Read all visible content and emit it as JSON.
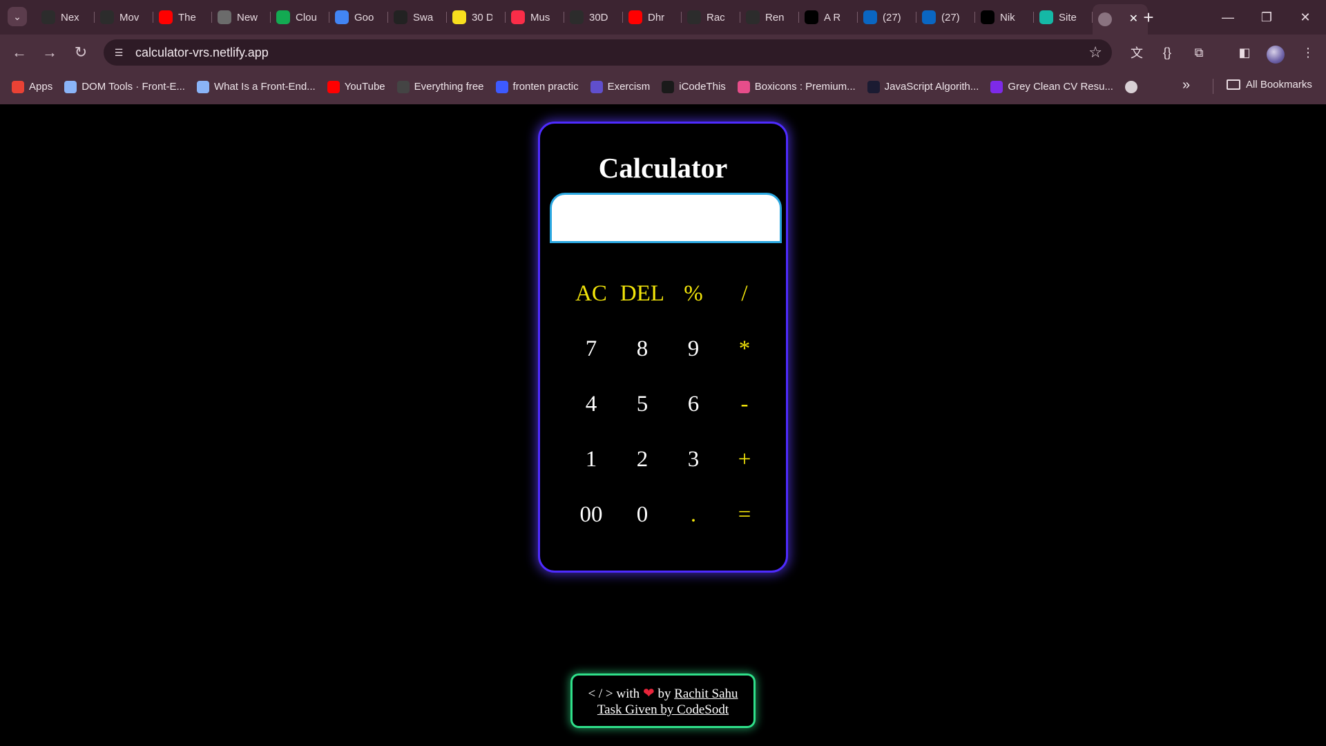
{
  "browser": {
    "tabs": [
      {
        "title": "Nex",
        "favicon": "openai-icon",
        "color": "#2c2c2c"
      },
      {
        "title": "Mov",
        "favicon": "m-icon",
        "color": "#2c2c2c"
      },
      {
        "title": "The",
        "favicon": "youtube-icon",
        "color": "#ff0000"
      },
      {
        "title": "New",
        "favicon": "chrome-icon",
        "color": "#6b6b6b"
      },
      {
        "title": "Clou",
        "favicon": "mongodb-leaf-icon",
        "color": "#13aa52"
      },
      {
        "title": "Goo",
        "favicon": "google-translate-icon",
        "color": "#4285f4"
      },
      {
        "title": "Swa",
        "favicon": "ss-icon",
        "color": "#222222"
      },
      {
        "title": "30 D",
        "favicon": "js-icon",
        "color": "#f7df1e"
      },
      {
        "title": "Mus",
        "favicon": "music-icon",
        "color": "#fa2d48"
      },
      {
        "title": "30D",
        "favicon": "github-icon",
        "color": "#2c2c2c"
      },
      {
        "title": "Dhr",
        "favicon": "youtube-icon",
        "color": "#ff0000"
      },
      {
        "title": "Rac",
        "favicon": "github-icon",
        "color": "#2c2c2c"
      },
      {
        "title": "Ren",
        "favicon": "render-icon",
        "color": "#2c2c2c"
      },
      {
        "title": "A R",
        "favicon": "triangle-icon",
        "color": "#000000"
      },
      {
        "title": "(27)",
        "favicon": "linkedin-icon",
        "color": "#0a66c2"
      },
      {
        "title": "(27)",
        "favicon": "linkedin-icon",
        "color": "#0a66c2"
      },
      {
        "title": "Nik",
        "favicon": "triangle-icon",
        "color": "#000000"
      },
      {
        "title": "Site",
        "favicon": "netlify-icon",
        "color": "#15b8a6"
      }
    ],
    "active_tab_close": "✕",
    "url": "calculator-vrs.netlify.app",
    "bookmarks": [
      {
        "label": "Apps",
        "icon": "apps-grid-icon",
        "color": "#e94235"
      },
      {
        "label": "DOM Tools · Front-E...",
        "icon": "book-icon",
        "color": "#8ab4f8"
      },
      {
        "label": "What Is a Front-End...",
        "icon": "book-icon",
        "color": "#8ab4f8"
      },
      {
        "label": "YouTube",
        "icon": "youtube-icon",
        "color": "#ff0000"
      },
      {
        "label": "Everything free",
        "icon": "github-icon",
        "color": "#444444"
      },
      {
        "label": "fronten practic",
        "icon": "code-icon",
        "color": "#3d5afe"
      },
      {
        "label": "Exercism",
        "icon": "exercism-icon",
        "color": "#604fcd"
      },
      {
        "label": "iCodeThis",
        "icon": "icodethis-icon",
        "color": "#1a1a1a"
      },
      {
        "label": "Boxicons : Premium...",
        "icon": "boxicons-icon",
        "color": "#e64d8a"
      },
      {
        "label": "JavaScript Algorith...",
        "icon": "fcc-icon",
        "color": "#1b1b32"
      },
      {
        "label": "Grey Clean CV Resu...",
        "icon": "canva-icon",
        "color": "#7d2ae8"
      }
    ],
    "all_bookmarks": "All Bookmarks"
  },
  "calculator": {
    "title": "Calculator",
    "display_value": "",
    "keys": [
      {
        "label": "AC",
        "type": "op",
        "name": "clear"
      },
      {
        "label": "DEL",
        "type": "op",
        "name": "delete"
      },
      {
        "label": "%",
        "type": "op",
        "name": "percent"
      },
      {
        "label": "/",
        "type": "op",
        "name": "divide"
      },
      {
        "label": "7",
        "type": "num",
        "name": "7"
      },
      {
        "label": "8",
        "type": "num",
        "name": "8"
      },
      {
        "label": "9",
        "type": "num",
        "name": "9"
      },
      {
        "label": "*",
        "type": "op",
        "name": "multiply"
      },
      {
        "label": "4",
        "type": "num",
        "name": "4"
      },
      {
        "label": "5",
        "type": "num",
        "name": "5"
      },
      {
        "label": "6",
        "type": "num",
        "name": "6"
      },
      {
        "label": "-",
        "type": "op",
        "name": "subtract"
      },
      {
        "label": "1",
        "type": "num",
        "name": "1"
      },
      {
        "label": "2",
        "type": "num",
        "name": "2"
      },
      {
        "label": "3",
        "type": "num",
        "name": "3"
      },
      {
        "label": "+",
        "type": "op",
        "name": "add"
      },
      {
        "label": "00",
        "type": "num",
        "name": "double-zero"
      },
      {
        "label": "0",
        "type": "num",
        "name": "0"
      },
      {
        "label": ".",
        "type": "op",
        "name": "decimal"
      },
      {
        "label": "=",
        "type": "op",
        "name": "equals"
      }
    ]
  },
  "footer": {
    "code_symbol": "< / >",
    "with_text": "with",
    "heart": "❤",
    "by_text": "by",
    "author": "Rachit Sahu",
    "task_text": "Task Given by CodeSodt"
  },
  "colors": {
    "calculator_border": "#4e2bff",
    "operator_keys": "#f2e40a",
    "display_border": "#2aa7e0",
    "footer_border": "#2fe08a"
  }
}
